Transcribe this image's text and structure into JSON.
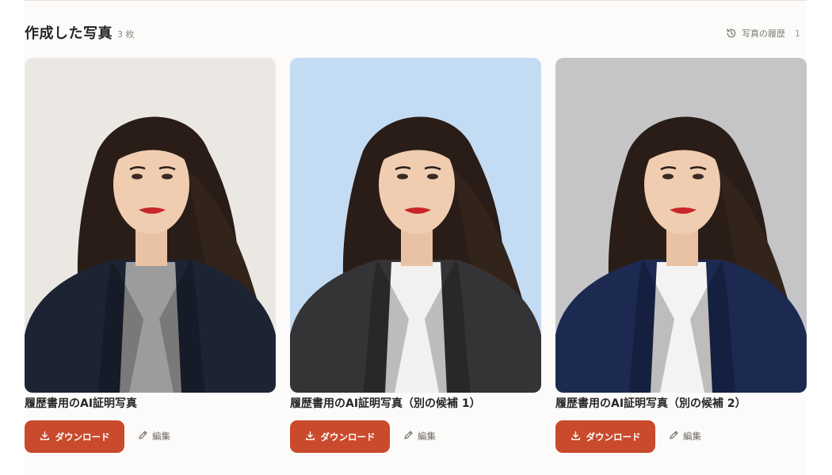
{
  "header": {
    "title": "作成した写真",
    "count": "3 枚",
    "history_label": "写真の履歴",
    "history_count": "1",
    "history_icon": "history-icon"
  },
  "photos": [
    {
      "caption": "履歴書用のAI証明写真",
      "download_label": "ダウンロード",
      "edit_label": "編集",
      "background_color": "#ebe8e3",
      "jacket_color": "#1c2434",
      "top_color": "#9c9c9d"
    },
    {
      "caption": "履歴書用のAI証明写真（別の候補 1）",
      "download_label": "ダウンロード",
      "edit_label": "編集",
      "background_color": "#c4dcf3",
      "jacket_color": "#343436",
      "top_color": "#f2f1ef"
    },
    {
      "caption": "履歴書用のAI証明写真（別の候補 2）",
      "download_label": "ダウンロード",
      "edit_label": "編集",
      "background_color": "#c5c5c8",
      "jacket_color": "#1c2a52",
      "top_color": "#f4f3f1"
    }
  ],
  "colors": {
    "accent": "#c94a2c",
    "page_background": "#fcfbf9"
  }
}
